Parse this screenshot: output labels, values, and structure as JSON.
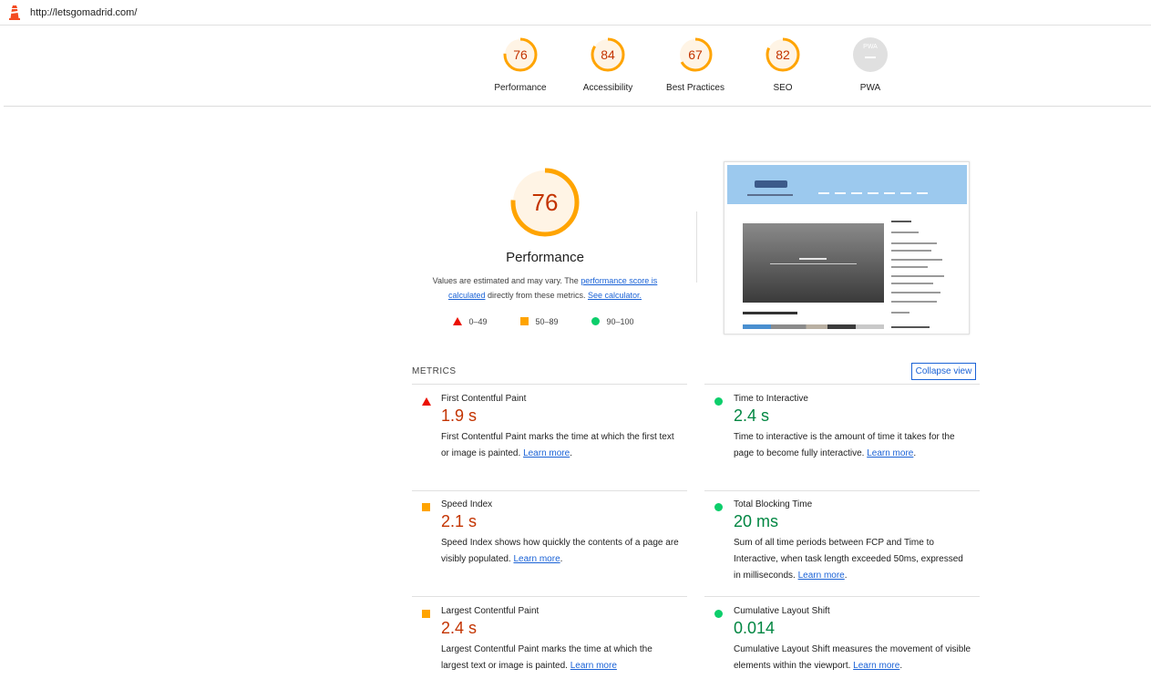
{
  "topbar": {
    "url": "http://letsgomadrid.com/"
  },
  "gauges": [
    {
      "score": "76",
      "label": "Performance",
      "fraction": 0.76,
      "color": "#ffa400"
    },
    {
      "score": "84",
      "label": "Accessibility",
      "fraction": 0.84,
      "color": "#ffa400"
    },
    {
      "score": "67",
      "label": "Best Practices",
      "fraction": 0.67,
      "color": "#ffa400"
    },
    {
      "score": "82",
      "label": "SEO",
      "fraction": 0.82,
      "color": "#ffa400"
    },
    {
      "score": "PWA",
      "label": "PWA",
      "fraction": 0,
      "color": "#e0e0e0"
    }
  ],
  "summary": {
    "score": "76",
    "score_fraction": 0.76,
    "title": "Performance",
    "desc_pre": "Values are estimated and may vary. The ",
    "desc_link1": "performance score is calculated",
    "desc_mid": " directly from these metrics. ",
    "desc_link2": "See calculator."
  },
  "legend": {
    "fail": "0–49",
    "average": "50–89",
    "pass": "90–100"
  },
  "metrics": {
    "heading": "METRICS",
    "collapse_label": "Collapse view",
    "items": [
      {
        "title": "First Contentful Paint",
        "value": "1.9 s",
        "status": "fail",
        "desc": "First Contentful Paint marks the time at which the first text or image is painted. ",
        "link": "Learn more",
        "tail": "."
      },
      {
        "title": "Time to Interactive",
        "value": "2.4 s",
        "status": "pass",
        "desc": "Time to interactive is the amount of time it takes for the page to become fully interactive. ",
        "link": "Learn more",
        "tail": "."
      },
      {
        "title": "Speed Index",
        "value": "2.1 s",
        "status": "average",
        "desc": "Speed Index shows how quickly the contents of a page are visibly populated. ",
        "link": "Learn more",
        "tail": "."
      },
      {
        "title": "Total Blocking Time",
        "value": "20 ms",
        "status": "pass",
        "desc": "Sum of all time periods between FCP and Time to Interactive, when task length exceeded 50ms, expressed in milliseconds. ",
        "link": "Learn more",
        "tail": "."
      },
      {
        "title": "Largest Contentful Paint",
        "value": "2.4 s",
        "status": "average",
        "desc": "Largest Contentful Paint marks the time at which the largest text or image is painted. ",
        "link": "Learn more",
        "tail": ""
      },
      {
        "title": "Cumulative Layout Shift",
        "value": "0.014",
        "status": "pass",
        "desc": "Cumulative Layout Shift measures the movement of visible elements within the viewport. ",
        "link": "Learn more",
        "tail": "."
      }
    ]
  },
  "colors": {
    "fail": "#eb0f00",
    "average": "#ffa400",
    "pass": "#0cce6b",
    "link": "#1a62d6"
  }
}
